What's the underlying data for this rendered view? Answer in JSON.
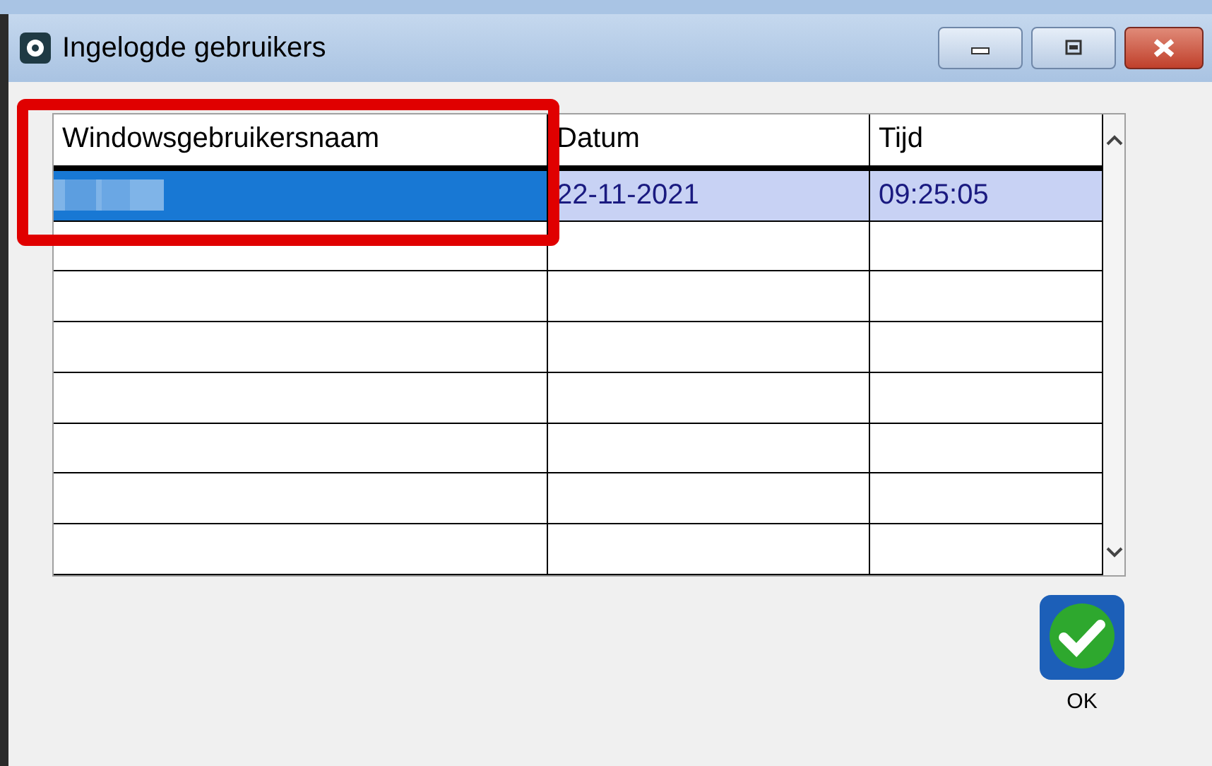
{
  "window": {
    "title": "Ingelogde gebruikers"
  },
  "table": {
    "columns": [
      "Windowsgebruikersnaam",
      "Datum",
      "Tijd"
    ],
    "rows": [
      {
        "selected": true,
        "name_redacted": true,
        "datum": "22-11-2021",
        "tijd": "09:25:05"
      },
      {
        "selected": false
      },
      {
        "selected": false
      },
      {
        "selected": false
      },
      {
        "selected": false
      },
      {
        "selected": false
      },
      {
        "selected": false
      },
      {
        "selected": false
      }
    ]
  },
  "annotation": {
    "kind": "highlight-box",
    "color": "#e00000"
  },
  "buttons": [
    {
      "label": "OK"
    }
  ]
}
